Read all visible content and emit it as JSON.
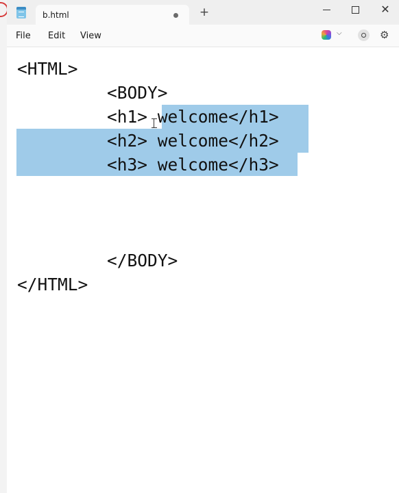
{
  "tab": {
    "title": "b.html",
    "new_tab": "+"
  },
  "window_controls": {
    "close": "✕"
  },
  "menu": {
    "file": "File",
    "edit": "Edit",
    "view": "View"
  },
  "toolbar": {
    "copilot_chevron": "⌵",
    "settings": "⚙"
  },
  "editor": {
    "lines": [
      "<HTML>",
      "<BODY>",
      "<h1> welcome</h1>",
      "<h2> welcome</h2>",
      "<h3> welcome</h3>",
      "</BODY>",
      "</HTML>"
    ],
    "selected_text": "welcome</h1>\n<h2> welcome</h2>\n<h3> welcome</h3>"
  },
  "colors": {
    "selection": "#9fcbe9",
    "titlebar": "#efefef",
    "text": "#111111"
  }
}
